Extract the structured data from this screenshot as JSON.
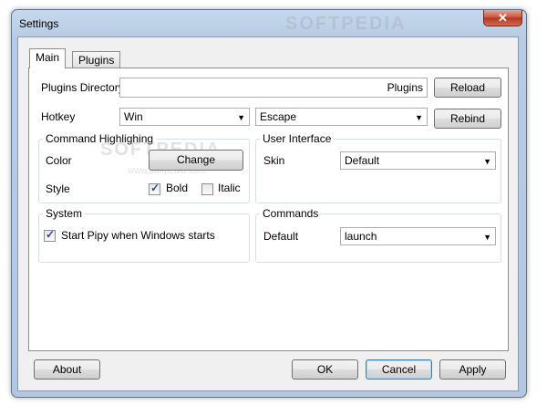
{
  "window": {
    "title": "Settings",
    "close_glyph": "✕"
  },
  "tabs": [
    {
      "label": "Main",
      "active": true
    },
    {
      "label": "Plugins",
      "active": false
    }
  ],
  "plugins_directory": {
    "label": "Plugins Directory",
    "value": "Plugins",
    "reload_label": "Reload"
  },
  "hotkey": {
    "label": "Hotkey",
    "modifier": "Win",
    "key": "Escape",
    "rebind_label": "Rebind"
  },
  "command_highlighting": {
    "title": "Command Highlighing",
    "color_label": "Color",
    "change_label": "Change",
    "style_label": "Style",
    "bold_label": "Bold",
    "bold_checked": true,
    "italic_label": "Italic",
    "italic_checked": false
  },
  "user_interface": {
    "title": "User Interface",
    "skin_label": "Skin",
    "skin_value": "Default"
  },
  "system": {
    "title": "System",
    "startup_label": "Start Pipy when Windows starts",
    "startup_checked": true
  },
  "commands": {
    "title": "Commands",
    "default_label": "Default",
    "default_value": "launch"
  },
  "footer": {
    "about_label": "About",
    "ok_label": "OK",
    "cancel_label": "Cancel",
    "apply_label": "Apply"
  },
  "watermark": {
    "main": "SOFTPEDIA",
    "sub": "www.softpedia.com"
  },
  "icons": {
    "dropdown": "chevron-down-icon",
    "check": "check-icon",
    "close": "close-icon"
  }
}
